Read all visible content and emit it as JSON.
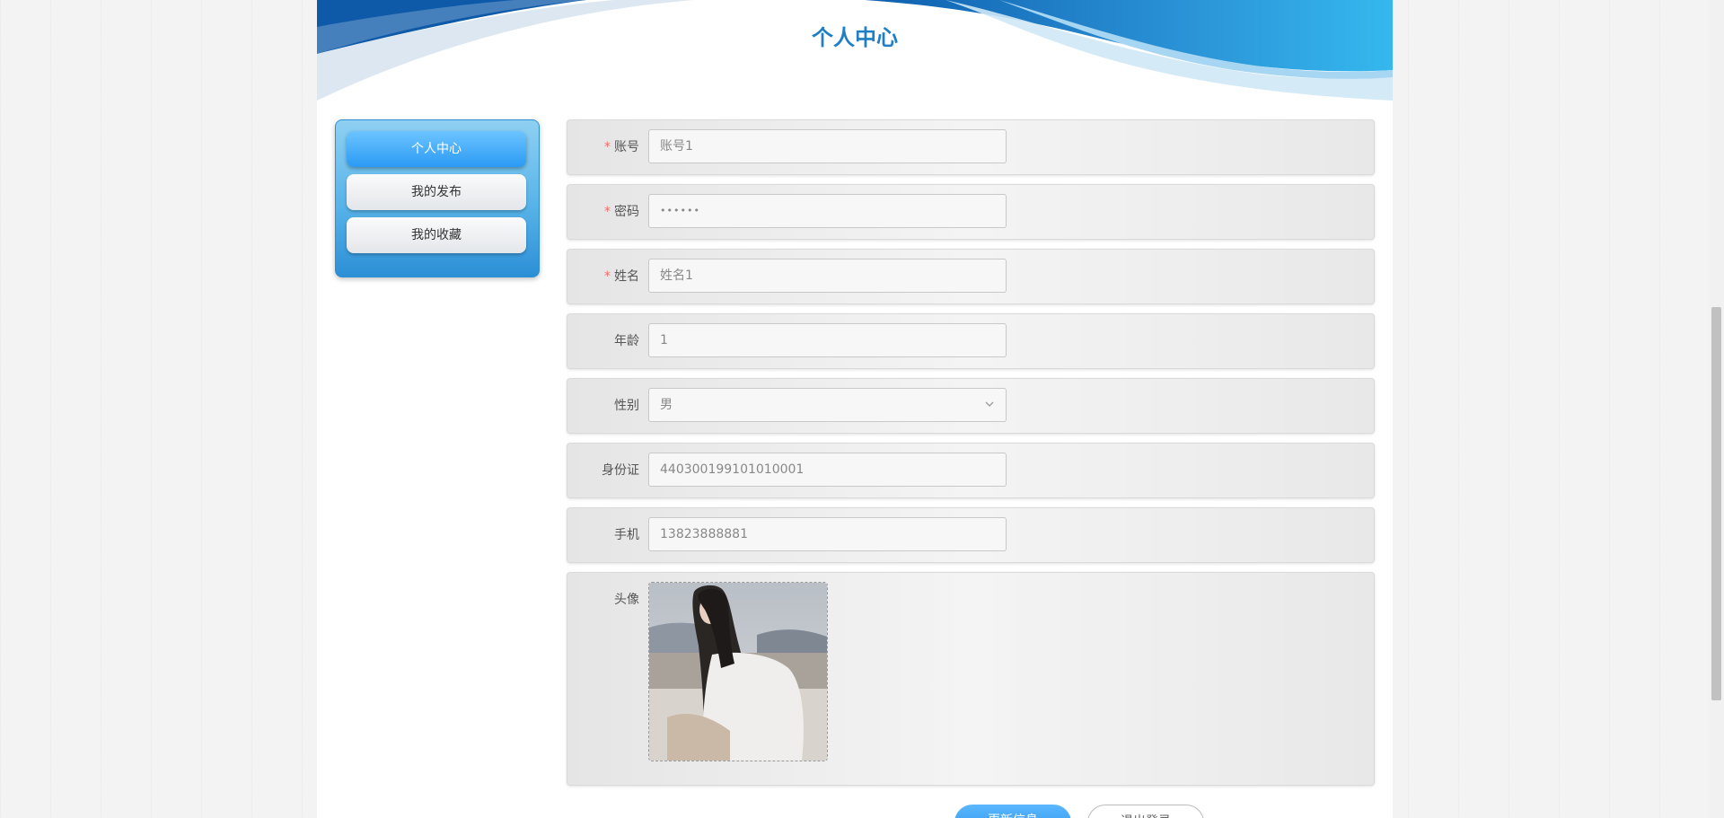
{
  "header": {
    "title": "个人中心"
  },
  "sidebar": {
    "items": [
      {
        "label": "个人中心",
        "active": true
      },
      {
        "label": "我的发布",
        "active": false
      },
      {
        "label": "我的收藏",
        "active": false
      }
    ]
  },
  "form": {
    "account": {
      "label": "账号",
      "required": true,
      "value": "账号1"
    },
    "password": {
      "label": "密码",
      "required": true,
      "value": "••••••"
    },
    "name": {
      "label": "姓名",
      "required": true,
      "value": "姓名1"
    },
    "age": {
      "label": "年龄",
      "required": false,
      "value": "1"
    },
    "gender": {
      "label": "性别",
      "required": false,
      "value": "男"
    },
    "id_card": {
      "label": "身份证",
      "required": false,
      "value": "440300199101010001"
    },
    "phone": {
      "label": "手机",
      "required": false,
      "value": "13823888881"
    },
    "avatar": {
      "label": "头像"
    }
  },
  "actions": {
    "update_label": "更新信息",
    "logout_label": "退出登录"
  },
  "colors": {
    "accent": "#2b9af3",
    "title": "#1f7fc4",
    "required": "#f56c6c"
  }
}
